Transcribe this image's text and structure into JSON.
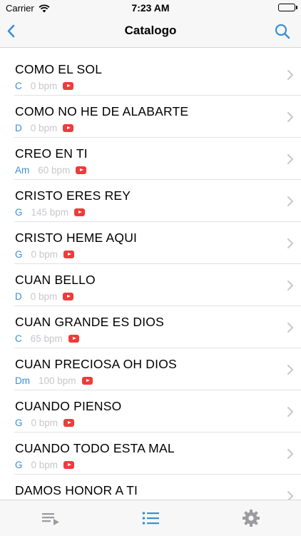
{
  "status_bar": {
    "carrier": "Carrier",
    "time": "7:23 AM"
  },
  "nav": {
    "title": "Catalogo"
  },
  "colors": {
    "accent": "#3a8fd6",
    "youtube": "#ef3b3b",
    "bpm_text": "#c7c7cc"
  },
  "songs": [
    {
      "title": "COMO EL SOL",
      "key": "C",
      "bpm": "0 bpm",
      "icon": "youtube-icon"
    },
    {
      "title": "COMO NO HE DE ALABARTE",
      "key": "D",
      "bpm": "0 bpm",
      "icon": "youtube-icon"
    },
    {
      "title": "CREO EN TI",
      "key": "Am",
      "bpm": "60 bpm",
      "icon": "youtube-icon"
    },
    {
      "title": "CRISTO ERES REY",
      "key": "G",
      "bpm": "145 bpm",
      "icon": "youtube-icon"
    },
    {
      "title": "CRISTO HEME AQUI",
      "key": "G",
      "bpm": "0 bpm",
      "icon": "youtube-icon"
    },
    {
      "title": "CUAN BELLO",
      "key": "D",
      "bpm": "0 bpm",
      "icon": "youtube-icon"
    },
    {
      "title": "CUAN GRANDE ES DIOS",
      "key": "C",
      "bpm": "65 bpm",
      "icon": "youtube-icon"
    },
    {
      "title": "CUAN PRECIOSA OH DIOS",
      "key": "Dm",
      "bpm": "100 bpm",
      "icon": "youtube-icon"
    },
    {
      "title": "CUANDO PIENSO",
      "key": "G",
      "bpm": "0 bpm",
      "icon": "youtube-icon"
    },
    {
      "title": "CUANDO TODO ESTA MAL",
      "key": "G",
      "bpm": "0 bpm",
      "icon": "youtube-icon"
    },
    {
      "title": "DAMOS HONOR A TI",
      "key": "",
      "bpm": "",
      "icon": ""
    }
  ],
  "tab_bar": {
    "tabs": [
      {
        "icon": "playlist-icon",
        "active": false
      },
      {
        "icon": "list-icon",
        "active": true
      },
      {
        "icon": "gear-icon",
        "active": false
      }
    ]
  }
}
